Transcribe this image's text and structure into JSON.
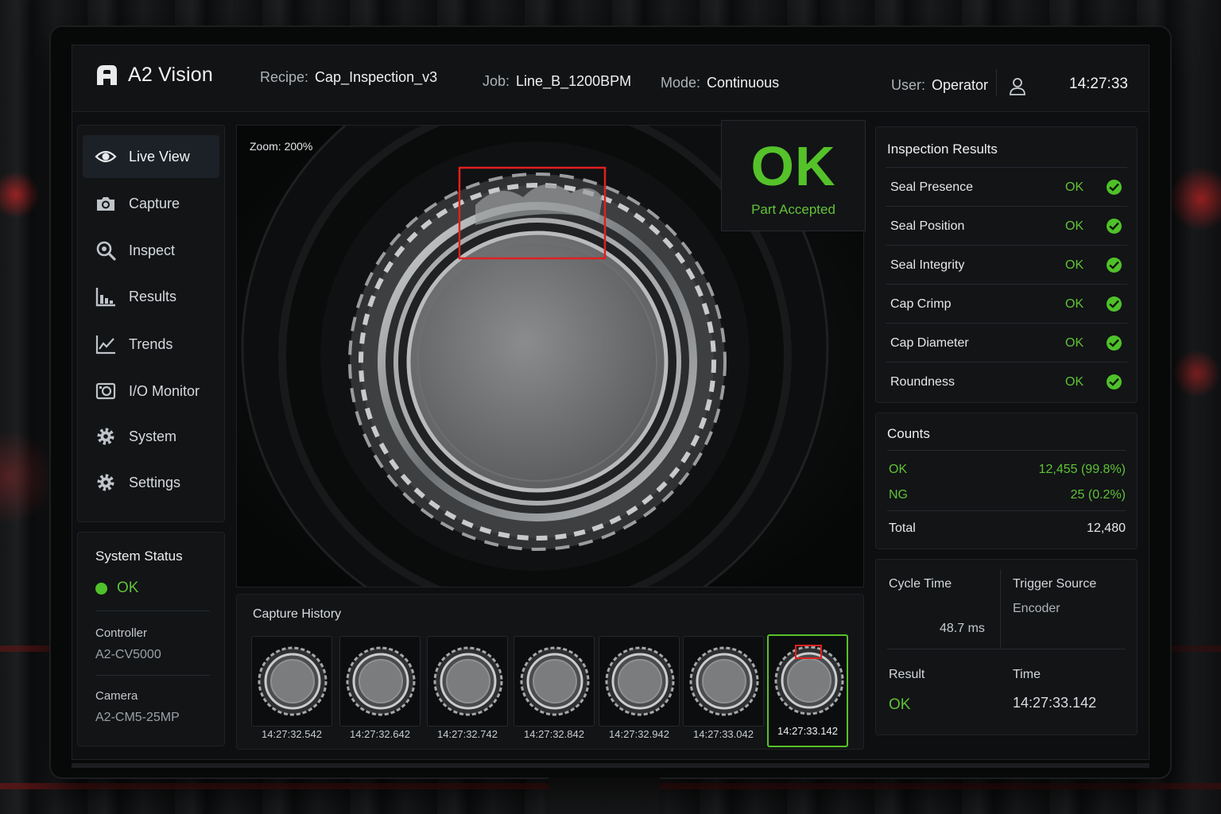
{
  "app": {
    "name": "A2 Vision"
  },
  "header": {
    "recipe_label": "Recipe:",
    "recipe_value": "Cap_Inspection_v3",
    "job_label": "Job:",
    "job_value": "Line_B_1200BPM",
    "mode_label": "Mode:",
    "mode_value": "Continuous",
    "user_label": "User:",
    "user_value": "Operator",
    "clock": "14:27:33"
  },
  "sidebar": {
    "items": [
      {
        "label": "Live View",
        "icon": "eye-icon",
        "active": true
      },
      {
        "label": "Capture",
        "icon": "camera-icon"
      },
      {
        "label": "Inspect",
        "icon": "magnifier-icon"
      },
      {
        "label": "Results",
        "icon": "bar-chart-icon"
      },
      {
        "label": "Trends",
        "icon": "line-chart-icon"
      },
      {
        "label": "I/O Monitor",
        "icon": "io-monitor-icon"
      },
      {
        "label": "System",
        "icon": "gear-icon"
      },
      {
        "label": "Settings",
        "icon": "gear-icon"
      }
    ]
  },
  "system_status": {
    "title": "System Status",
    "status": "OK",
    "controller_label": "Controller",
    "controller_value": "A2-CV5000",
    "camera_label": "Camera",
    "camera_value": "A2-CM5-25MP"
  },
  "viewer": {
    "zoom": "Zoom: 200%"
  },
  "verdict": {
    "result": "OK",
    "text": "Part Accepted",
    "color": "#55c22a"
  },
  "capture_history": {
    "title": "Capture History",
    "items": [
      {
        "time": "14:27:32.542"
      },
      {
        "time": "14:27:32.642"
      },
      {
        "time": "14:27:32.742"
      },
      {
        "time": "14:27:32.842"
      },
      {
        "time": "14:27:32.942"
      },
      {
        "time": "14:27:33.042"
      },
      {
        "time": "14:27:33.142",
        "selected": true
      }
    ]
  },
  "inspection_results": {
    "title": "Inspection Results",
    "rows": [
      {
        "name": "Seal Presence",
        "value": "OK"
      },
      {
        "name": "Seal Position",
        "value": "OK"
      },
      {
        "name": "Seal Integrity",
        "value": "OK"
      },
      {
        "name": "Cap Crimp",
        "value": "OK"
      },
      {
        "name": "Cap Diameter",
        "value": "OK"
      },
      {
        "name": "Roundness",
        "value": "OK"
      }
    ]
  },
  "counts": {
    "title": "Counts",
    "ok_label": "OK",
    "ok_value": "12,455 (99.8%)",
    "ng_label": "NG",
    "ng_value": "25  (0.2%)",
    "total_label": "Total",
    "total_value": "12,480"
  },
  "cycle": {
    "cycle_time_label": "Cycle Time",
    "cycle_time_value": "48.7 ms",
    "trigger_label": "Trigger Source",
    "trigger_value": "Encoder",
    "result_label": "Result",
    "result_value": "OK",
    "time_label": "Time",
    "time_value": "14:27:33.142"
  },
  "colors": {
    "accent_green": "#55c22a",
    "roi_red": "#e02020",
    "panel_bg": "#121416"
  }
}
